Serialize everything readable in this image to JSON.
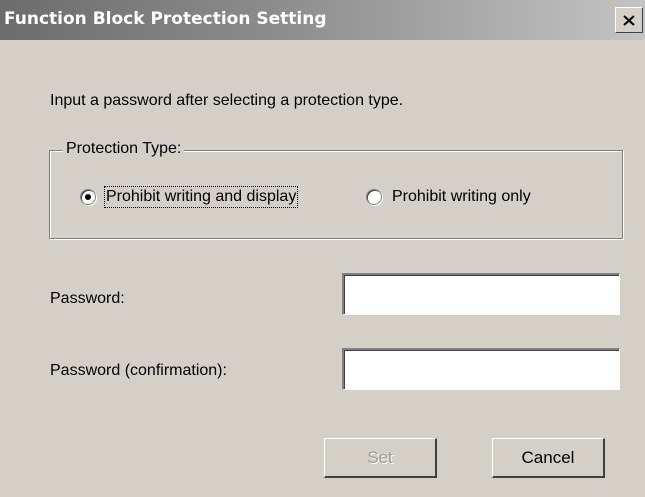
{
  "dialog": {
    "title": "Function Block Protection Setting",
    "close_glyph": "X",
    "instruction": "Input a password after selecting a protection type.",
    "protection_type": {
      "label": "Protection Type:",
      "options": [
        {
          "label": "Prohibit writing and display",
          "selected": true
        },
        {
          "label": "Prohibit writing only",
          "selected": false
        }
      ]
    },
    "password": {
      "label": "Password:",
      "value": ""
    },
    "password_confirmation": {
      "label": "Password (confirmation):",
      "value": ""
    },
    "buttons": {
      "set": {
        "label": "Set",
        "enabled": false
      },
      "cancel": {
        "label": "Cancel",
        "enabled": true
      }
    }
  }
}
